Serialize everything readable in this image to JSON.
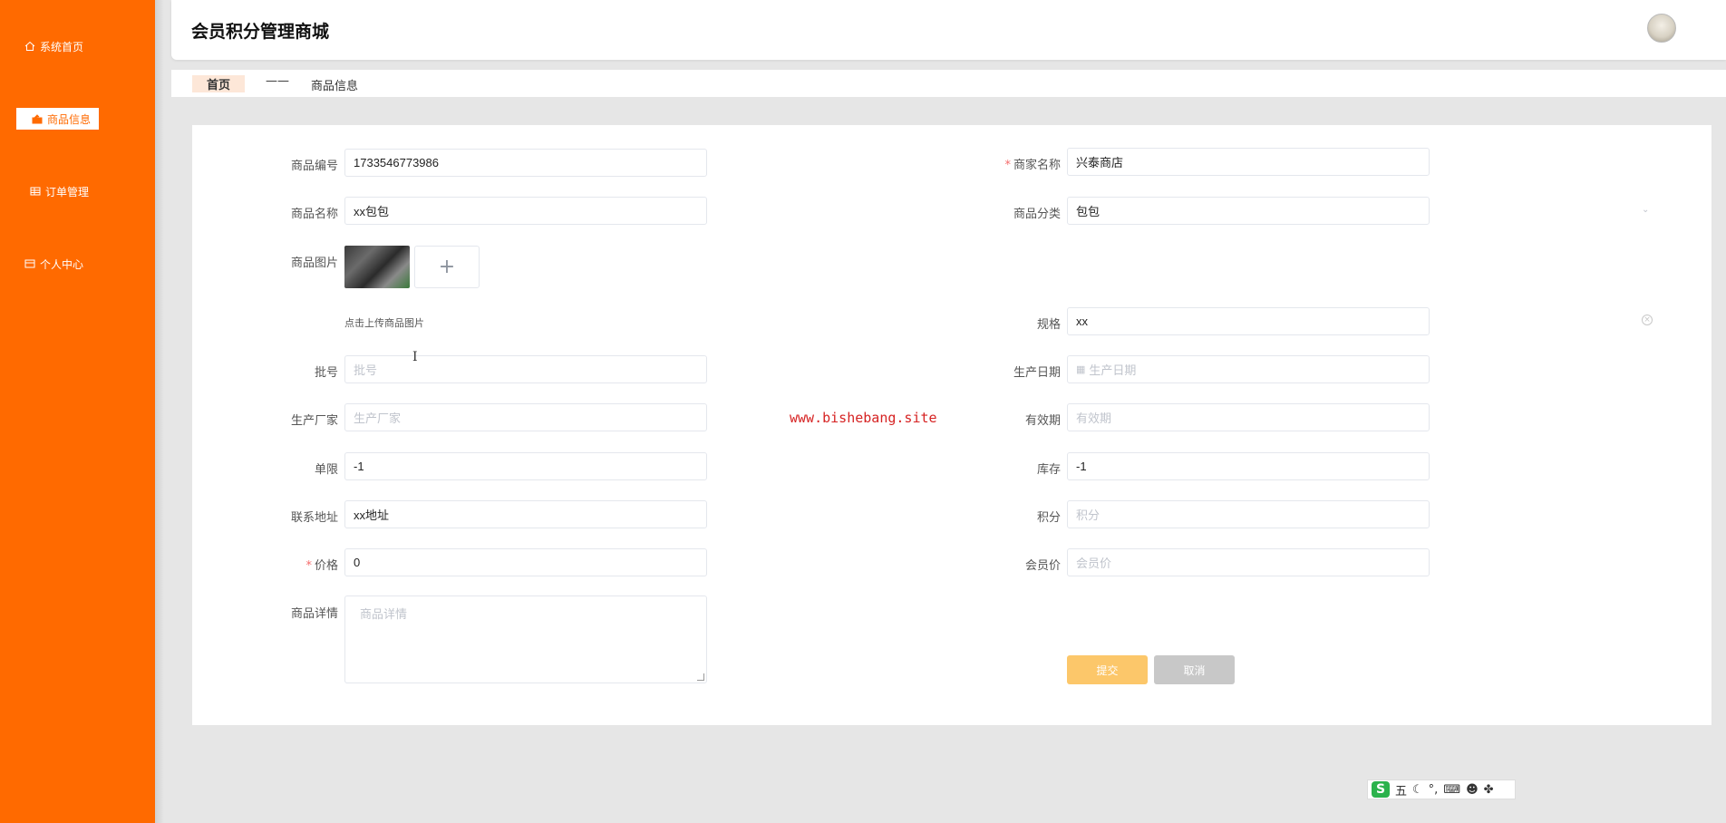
{
  "app": {
    "title": "会员积分管理商城"
  },
  "sidebar": {
    "items": [
      {
        "label": "系统首页",
        "icon": "home-icon"
      },
      {
        "label": "商品信息",
        "icon": "goods-icon",
        "active": true
      },
      {
        "label": "订单管理",
        "icon": "table-icon"
      },
      {
        "label": "个人中心",
        "icon": "user-card-icon"
      }
    ]
  },
  "breadcrumb": {
    "home": "首页",
    "separator": "——",
    "current": "商品信息"
  },
  "form": {
    "product_code": {
      "label": "商品编号",
      "value": "1733546773986"
    },
    "merchant_name": {
      "label": "商家名称",
      "value": "兴泰商店",
      "required": "*"
    },
    "product_name": {
      "label": "商品名称",
      "value": "xx包包"
    },
    "category": {
      "label": "商品分类",
      "value": "包包"
    },
    "image": {
      "label": "商品图片",
      "hint": "点击上传商品图片",
      "upload_symbol": "+"
    },
    "spec": {
      "label": "规格",
      "value": "xx"
    },
    "batch": {
      "label": "批号",
      "placeholder": "批号"
    },
    "production_date": {
      "label": "生产日期",
      "placeholder": "生产日期"
    },
    "manufacturer": {
      "label": "生产厂家",
      "placeholder": "生产厂家"
    },
    "expiry": {
      "label": "有效期",
      "placeholder": "有效期"
    },
    "limit": {
      "label": "单限",
      "value": "-1"
    },
    "stock": {
      "label": "库存",
      "value": "-1"
    },
    "address": {
      "label": "联系地址",
      "value": "xx地址"
    },
    "points": {
      "label": "积分",
      "placeholder": "积分"
    },
    "price": {
      "label": "价格",
      "value": "0",
      "required": "*"
    },
    "member_price": {
      "label": "会员价",
      "placeholder": "会员价"
    },
    "details": {
      "label": "商品详情",
      "placeholder": "商品详情"
    },
    "submit_label": "提交",
    "cancel_label": "取消"
  },
  "watermark": "www.bishebang.site",
  "ime": {
    "logo": "S",
    "mode": "五",
    "moon": "☾",
    "punct": "°,",
    "kb": "⌨",
    "user": "☻",
    "grid": "✤"
  },
  "colors": {
    "sidebar": "#ff6a00",
    "submit": "#fcc76a",
    "cancel": "#c8c8c8",
    "required": "#f56c6c"
  }
}
